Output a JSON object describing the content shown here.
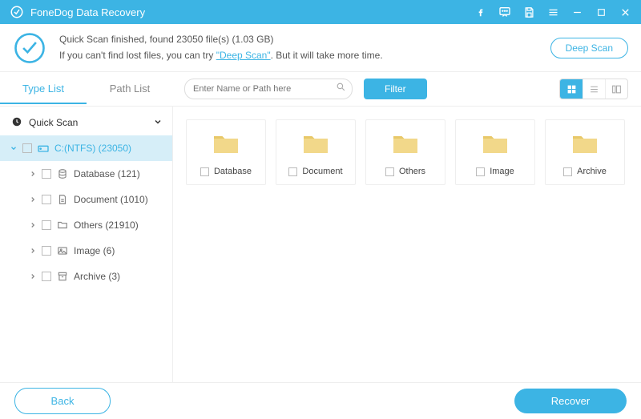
{
  "titlebar": {
    "title": "FoneDog Data Recovery"
  },
  "banner": {
    "line1_prefix": "Quick Scan finished, found ",
    "line1_count": "23050",
    "line1_suffix": " file(s) (1.03 GB)",
    "line2_prefix": "If you can't find lost files, you can try ",
    "line2_link": "\"Deep Scan\"",
    "line2_suffix": ". But it will take more time.",
    "deep_scan": "Deep Scan"
  },
  "tabs": {
    "type_list": "Type List",
    "path_list": "Path List"
  },
  "search": {
    "placeholder": "Enter Name or Path here"
  },
  "filter": "Filter",
  "tree": {
    "root": "Quick Scan",
    "drive": "C:(NTFS) (23050)",
    "items": [
      {
        "label": "Database (121)"
      },
      {
        "label": "Document (1010)"
      },
      {
        "label": "Others (21910)"
      },
      {
        "label": "Image (6)"
      },
      {
        "label": "Archive (3)"
      }
    ]
  },
  "folders": [
    {
      "label": "Database"
    },
    {
      "label": "Document"
    },
    {
      "label": "Others"
    },
    {
      "label": "Image"
    },
    {
      "label": "Archive"
    }
  ],
  "footer": {
    "back": "Back",
    "recover": "Recover"
  }
}
